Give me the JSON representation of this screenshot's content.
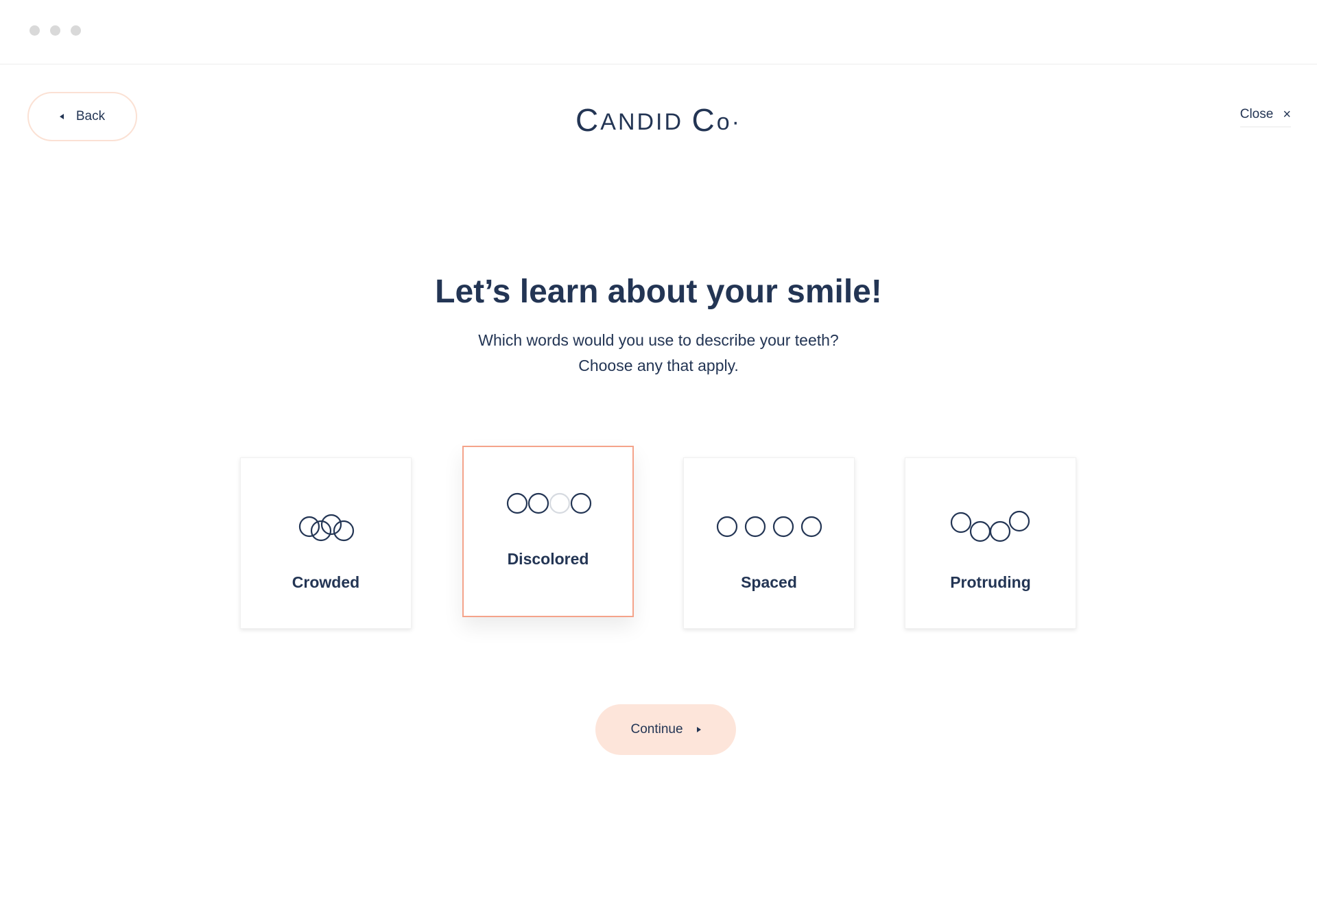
{
  "header": {
    "back_label": "Back",
    "logo_text_first": "C",
    "logo_text_mid": "ANDID ",
    "logo_text_second": "C",
    "logo_text_end": "o·",
    "close_label": "Close",
    "close_icon": "×"
  },
  "main": {
    "title": "Let’s learn about your smile!",
    "subtitle_line1": "Which words would you use to describe your teeth?",
    "subtitle_line2": "Choose any that apply."
  },
  "options": [
    {
      "label": "Crowded",
      "icon": "crowded-teeth-icon",
      "selected": false
    },
    {
      "label": "Discolored",
      "icon": "discolored-teeth-icon",
      "selected": true
    },
    {
      "label": "Spaced",
      "icon": "spaced-teeth-icon",
      "selected": false
    },
    {
      "label": "Protruding",
      "icon": "protruding-teeth-icon",
      "selected": false
    }
  ],
  "footer": {
    "continue_label": "Continue"
  },
  "colors": {
    "navy": "#233554",
    "accent_border": "#f4a38a",
    "button_fill": "#fde5da",
    "back_border": "#fbe1d4"
  }
}
